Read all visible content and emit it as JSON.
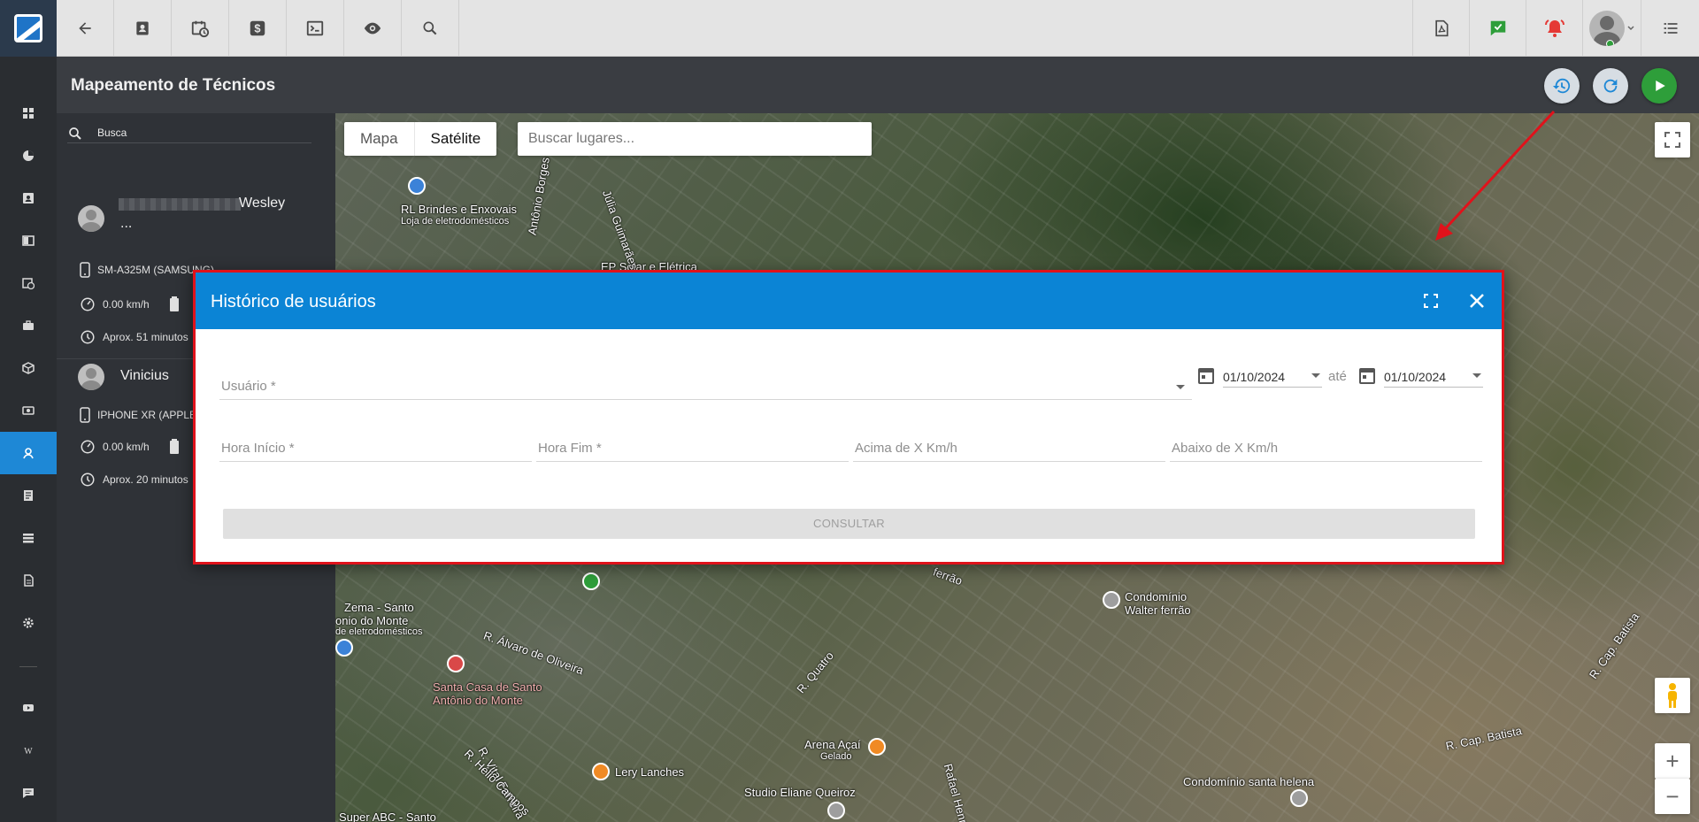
{
  "topbar": {
    "left_icons": [
      "back-arrow-icon",
      "contact-card-icon",
      "calendar-clock-icon",
      "dollar-icon",
      "terminal-icon",
      "eye-icon",
      "search-icon"
    ],
    "right_icons": [
      "pdf-icon",
      "chat-check-icon",
      "alarm-bell-icon",
      "user-avatar",
      "menu-list-icon"
    ]
  },
  "header": {
    "title": "Mapeamento de Técnicos"
  },
  "panel": {
    "search_label": "Busca",
    "technicians": [
      {
        "name": "Wesley",
        "name_suffix": "...",
        "device": "SM-A325M (SAMSUNG)",
        "speed": "0.00 km/h",
        "time": "Aprox. 51 minutos"
      },
      {
        "name": "Vinicius",
        "device": "IPHONE XR (APPLE)",
        "speed": "0.00 km/h",
        "time": "Aprox. 20 minutos"
      }
    ]
  },
  "map": {
    "type_map": "Mapa",
    "type_satellite": "Satélite",
    "search_placeholder": "Buscar lugares...",
    "labels": [
      "RL Brindes e Enxovais",
      "Loja de eletrodomésticos",
      "EP Solar e Elétrica",
      "Júlia Guimarães",
      "Antônio Borges",
      "Condomínio",
      "Walter ferrão",
      "R. Álvaro de Oliveira",
      "Santa Casa de Santo",
      "Antônio do Monte",
      "Zema - Santo",
      "onio do Monte",
      "de eletrodomésticos",
      "R. Quatro",
      "Arena Açaí",
      "Gelado",
      "Lery Lanches",
      "Studio Eliane Queiroz",
      "Condomínio santa helena",
      "R. Cap. Batista",
      "R. Cap. Batista",
      "R. Vital Ferreira",
      "R. Hélio Campos",
      "Rafael Henrique Ri",
      "Super ABC - Santo",
      "ferrão"
    ],
    "zoom_in": "+",
    "zoom_out": "−"
  },
  "modal": {
    "title": "Histórico de usuários",
    "user_label": "Usuário *",
    "date_from": "01/10/2024",
    "date_sep": "até",
    "date_to": "01/10/2024",
    "hour_start": "Hora Início *",
    "hour_end": "Hora Fim *",
    "above_speed": "Acima de X Km/h",
    "below_speed": "Abaixo de X Km/h",
    "consult": "CONSULTAR"
  },
  "colors": {
    "accent": "#0b84d5",
    "highlight_border": "#e0121b",
    "play_button": "#2e9e3a",
    "alarm": "#e53935"
  }
}
